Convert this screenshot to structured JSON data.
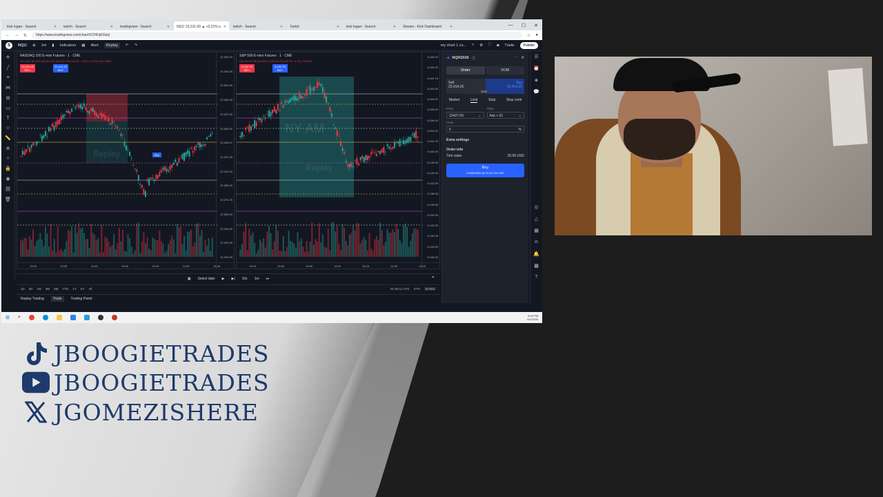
{
  "browser": {
    "tabs": [
      {
        "label": "kick logan - Search",
        "active": false
      },
      {
        "label": "twitch - Search",
        "active": false
      },
      {
        "label": "tradingview - Search",
        "active": false
      },
      {
        "label": "NQ1! 23,311.00 ▲ +0.21% u",
        "active": true
      },
      {
        "label": "twitch - Search",
        "active": false
      },
      {
        "label": "Twitch",
        "active": false
      },
      {
        "label": "kick logan - Search",
        "active": false
      },
      {
        "label": "Stream - Kick Dashboard",
        "active": false
      }
    ],
    "url": "https://www.tradingview.com/chart/UCHFqKGkq/"
  },
  "tv": {
    "symbol": "NQ1!",
    "timeframe": "1m",
    "indicators_label": "Indicators",
    "alert_label": "Alert",
    "replay_label": "Replay",
    "layout_label": "my chart 1 co...",
    "trade_label": "Trade",
    "publish_label": "Publish"
  },
  "chart_a": {
    "title": "NASDAQ 100 E-mini Futures · 1 · CME",
    "ohlc": "O22,415.50 H22,416.00 L22,414.00 C22,414.25 −1.50 (−0.01%)   Vol 1,869",
    "sell_price": "22,414.25",
    "sell_label": "SELL",
    "buy_price": "22,414.25",
    "buy_label": "BUY",
    "price_ticks": [
      "22,540.00",
      "22,526.25",
      "22,500.00",
      "22,480.00",
      "22,472.25",
      "22,460.00",
      "22,435.67",
      "22,421.25",
      "22,414.25",
      "22,380.00",
      "22,374.75",
      "22,360.00",
      "22,340.00",
      "22,320.00",
      "22,300.00"
    ],
    "time_ticks": [
      "13:15",
      "13:30",
      "13:45",
      "14:00",
      "14:15",
      "14:30",
      "14:45"
    ],
    "buy_tag": "Buy",
    "watermark": "Replay"
  },
  "chart_b": {
    "title": "S&P 500 E-mini Futures · 1 · CME",
    "ohlc": "O6,154.00 H6,154.50 L6,152.50 C6,152.75 −1.25 (−0.02%)",
    "sell_price": "6,152.75",
    "sell_label": "SELL",
    "buy_price": "6,152.75",
    "buy_label": "BUY",
    "price_ticks": [
      "6,168.00",
      "6,166.00",
      "6,164.75",
      "6,162.00",
      "6,160.00",
      "6,158.00",
      "6,156.00",
      "6,154.00",
      "6,152.75",
      "6,150.00",
      "6,148.00",
      "6,146.00",
      "6,142.50",
      "6,138.00",
      "6,136.50",
      "6,134.00",
      "6,132.00",
      "6,130.00",
      "6,128.00",
      "6,126.00"
    ],
    "time_ticks": [
      "13:15",
      "13:30",
      "13:45",
      "14:00",
      "14:15",
      "14:30",
      "14:45"
    ],
    "watermark": "NY AM",
    "watermark2": "Replay"
  },
  "replay_bar": {
    "select_date": "Select date",
    "speed": "10x",
    "interval": "1m"
  },
  "range_bar": {
    "ranges": [
      "1D",
      "5D",
      "1M",
      "3M",
      "6M",
      "YTD",
      "1Y",
      "5Y",
      "All"
    ],
    "clock": "01:00:12 UTC",
    "ext": "ETH",
    "adj": "B-ADJ"
  },
  "panel_tabs": [
    "Replay Trading",
    "Trade",
    "Trading Panel"
  ],
  "order_panel": {
    "symbol": "NQH2026",
    "tab_order": "Order",
    "tab_dom": "DOM",
    "sell_label": "Sell",
    "sell_price": "22,414.25",
    "buy_label": "Buy",
    "buy_price": "22,414.25",
    "spread": "0.00",
    "types": [
      "Market",
      "Limit",
      "Stop",
      "Stop Limit"
    ],
    "price_label": "Price",
    "price_value": "22427.00",
    "ticks_label": "Ticks",
    "ticks_value": "Ask + 51",
    "units_label": "Units",
    "units_value": "5",
    "units_suffix": "%",
    "extra": "Extra settings",
    "order_info": "Order info",
    "tick_value_label": "Tick value",
    "tick_value": "25.00 USD",
    "buy_button": "Buy",
    "buy_button_sub": "5 NQH2026 @ 22,427.00 LMT"
  },
  "taskbar": {
    "time": "5:00 PM",
    "date": "6/1/2026"
  },
  "social": [
    {
      "icon": "tiktok-icon",
      "handle": "JBOOGIETRADES"
    },
    {
      "icon": "youtube-icon",
      "handle": "JBOOGIETRADES"
    },
    {
      "icon": "x-icon",
      "handle": "JGOMEZISHERE"
    }
  ],
  "colors": {
    "accent": "#2962ff",
    "sell": "#f23645",
    "up": "#26a69a",
    "brand_text": "#1d3a6b"
  }
}
